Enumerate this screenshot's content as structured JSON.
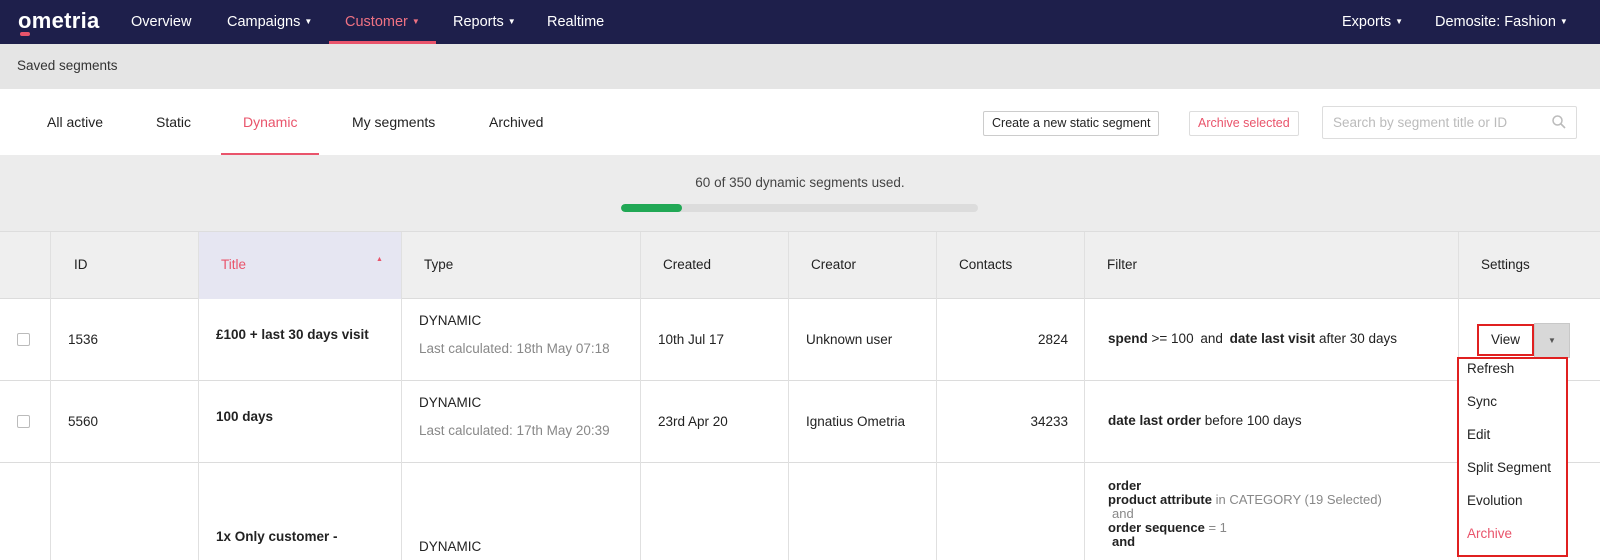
{
  "nav": {
    "logo": "ometria",
    "items": [
      {
        "label": "Overview",
        "caret": false
      },
      {
        "label": "Campaigns",
        "caret": true
      },
      {
        "label": "Customer",
        "caret": true,
        "active": true
      },
      {
        "label": "Reports",
        "caret": true
      },
      {
        "label": "Realtime",
        "caret": false
      }
    ],
    "right": [
      {
        "label": "Exports",
        "caret": true
      },
      {
        "label": "Demosite: Fashion",
        "caret": true
      }
    ]
  },
  "subbar": {
    "title": "Saved segments"
  },
  "tabs": [
    {
      "label": "All active"
    },
    {
      "label": "Static"
    },
    {
      "label": "Dynamic",
      "active": true
    },
    {
      "label": "My segments"
    },
    {
      "label": "Archived"
    }
  ],
  "actions": {
    "create_label": "Create a new static segment",
    "archive_label": "Archive selected",
    "search_placeholder": "Search by segment title or ID"
  },
  "usage": {
    "text": "60 of 350 dynamic segments used.",
    "used": 60,
    "total": 350,
    "color": "#21a855"
  },
  "table": {
    "headers": [
      "ID",
      "Title",
      "Type",
      "Created",
      "Creator",
      "Contacts",
      "Filter",
      "Settings"
    ],
    "sorted_column": "Title",
    "rows": [
      {
        "id": "1536",
        "title": "£100 + last 30 days visit",
        "type": "DYNAMIC",
        "calculated": "Last calculated: 18th May 07:18",
        "created": "10th Jul 17",
        "creator": "Unknown user",
        "contacts": "2824",
        "filter": {
          "f1": "spend",
          "f2": ">= 100",
          "f3": "and",
          "f4": "date last visit",
          "f5": "after 30 days"
        }
      },
      {
        "id": "5560",
        "title": "100 days",
        "type": "DYNAMIC",
        "calculated": "Last calculated: 17th May 20:39",
        "created": "23rd Apr 20",
        "creator": "Ignatius Ometria",
        "contacts": "34233",
        "filter": {
          "f1": "date last order",
          "f2": "before 100 days"
        }
      },
      {
        "title": "1x Only customer -",
        "type": "DYNAMIC",
        "filter": {
          "l1": "order",
          "l2a": "product attribute",
          "l2b": "in CATEGORY (19 Selected)",
          "l3": "and",
          "l4a": "order sequence",
          "l4b": "= 1",
          "l5": "and"
        }
      }
    ]
  },
  "settings": {
    "view_label": "View",
    "menu": [
      "Refresh",
      "Sync",
      "Edit",
      "Split Segment",
      "Evolution",
      "Archive"
    ]
  }
}
